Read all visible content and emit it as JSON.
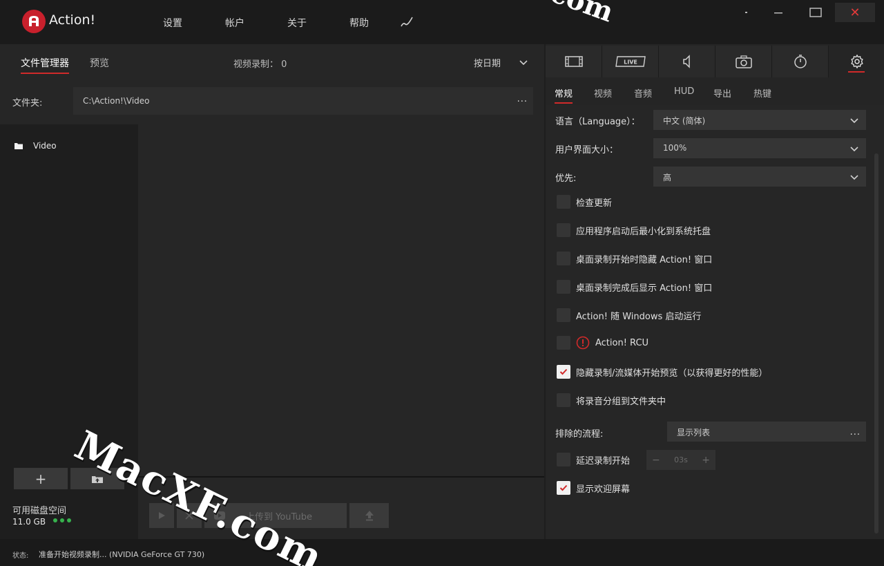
{
  "app": {
    "title": "Action!"
  },
  "menu": [
    "设置",
    "帐户",
    "关于",
    "帮助"
  ],
  "window": {
    "close_symbol": "✕"
  },
  "left": {
    "tabs": [
      "文件管理器",
      "预览"
    ],
    "recording_label": "视频录制：",
    "recording_count": "0",
    "sort_label": "按日期",
    "folder_label": "文件夹:",
    "folder_path": "C:\\Action!\\Video",
    "browse_dots": "...",
    "tree_item": "Video",
    "add_symbol": "+",
    "disk_label": "可用磁盘空间",
    "disk_size": "11.0 GB",
    "upload_youtube": "上传到 YouTube"
  },
  "right": {
    "icon_tabs": [
      "film-icon",
      "live-icon",
      "speaker-icon",
      "camera-icon",
      "timer-icon",
      "gear-icon"
    ],
    "live_badge": "LIVE",
    "subtabs": [
      "常规",
      "视频",
      "音频",
      "HUD",
      "导出",
      "热键"
    ],
    "language_label": "语言（Language）：",
    "language_value": "中文 (简体)",
    "ui_size_label": "用户界面大小：",
    "ui_size_value": "100%",
    "priority_label": "优先:",
    "priority_value": "高",
    "checkboxes": [
      {
        "label": "检查更新",
        "checked": false
      },
      {
        "label": "应用程序启动后最小化到系统托盘",
        "checked": false
      },
      {
        "label": "桌面录制开始时隐藏 Action! 窗口",
        "checked": false
      },
      {
        "label": "桌面录制完成后显示 Action! 窗口",
        "checked": false
      },
      {
        "label": "Action! 随 Windows 启动运行",
        "checked": false
      },
      {
        "label": "Action! RCU",
        "checked": false
      },
      {
        "label": "隐藏录制/流媒体开始预览（以获得更好的性能）",
        "checked": true
      },
      {
        "label": "将录音分组到文件夹中",
        "checked": false
      }
    ],
    "excluded_label": "排除的流程:",
    "excluded_value": "显示列表",
    "excluded_dots": "...",
    "delay_label": "延迟录制开始",
    "delay_value": "03s",
    "stepper_minus": "−",
    "stepper_plus": "+",
    "welcome_label": "显示欢迎屏幕"
  },
  "status": {
    "label": "状态:",
    "text": "准备开始视频录制... (NVIDIA GeForce GT 730)"
  },
  "watermark": {
    "text": "MacXF.com",
    "top_text": "com"
  },
  "colors": {
    "accent": "#d12a2a",
    "disk_ok": "#37b24d"
  }
}
